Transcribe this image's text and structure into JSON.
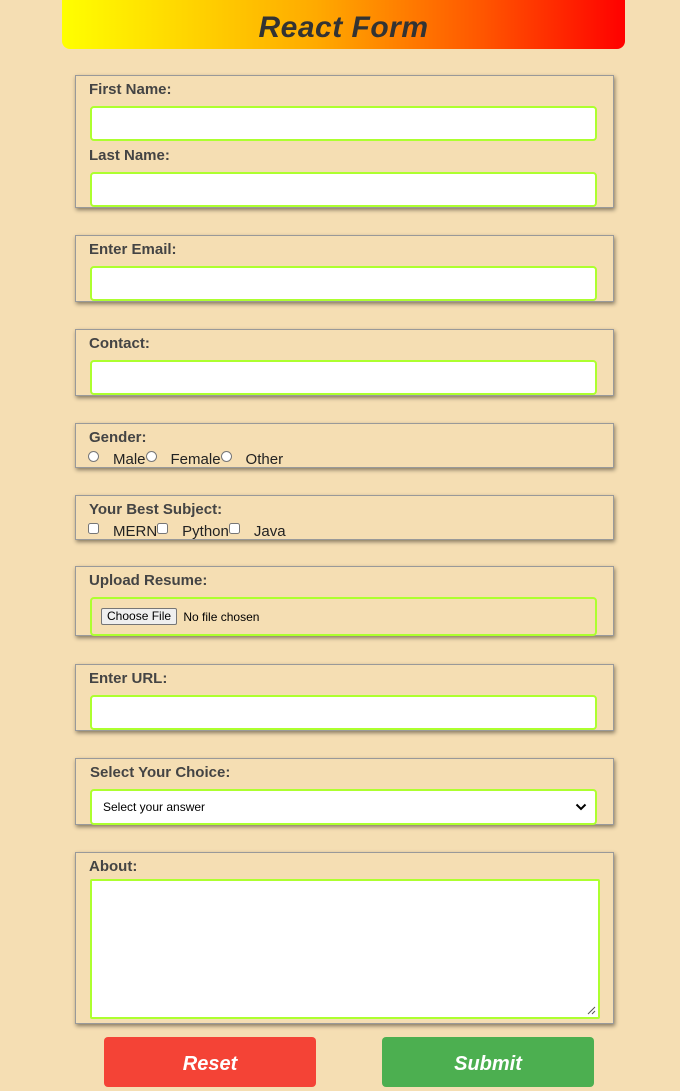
{
  "header": {
    "title": "React Form"
  },
  "name_section": {
    "first_label": "First Name:",
    "first_value": "",
    "last_label": "Last Name:",
    "last_value": ""
  },
  "email_section": {
    "label": "Enter Email:",
    "value": ""
  },
  "contact_section": {
    "label": "Contact:",
    "value": ""
  },
  "gender_section": {
    "label": "Gender:",
    "options": [
      "Male",
      "Female",
      "Other"
    ]
  },
  "subject_section": {
    "label": "Your Best Subject:",
    "options": [
      "MERN",
      "Python",
      "Java"
    ]
  },
  "resume_section": {
    "label": "Upload Resume:",
    "button_label": "Choose File",
    "status": "No file chosen"
  },
  "url_section": {
    "label": "Enter URL:",
    "value": ""
  },
  "choice_section": {
    "label": "Select Your Choice:",
    "selected": "Select your answer"
  },
  "about_section": {
    "label": "About:",
    "value": ""
  },
  "actions": {
    "reset_label": "Reset",
    "submit_label": "Submit"
  },
  "colors": {
    "background": "#f5deb3",
    "field_border": "#adff2f",
    "reset": "#f44336",
    "submit": "#4caf50",
    "header_gradient": [
      "#ffff00",
      "#ff0000"
    ]
  }
}
